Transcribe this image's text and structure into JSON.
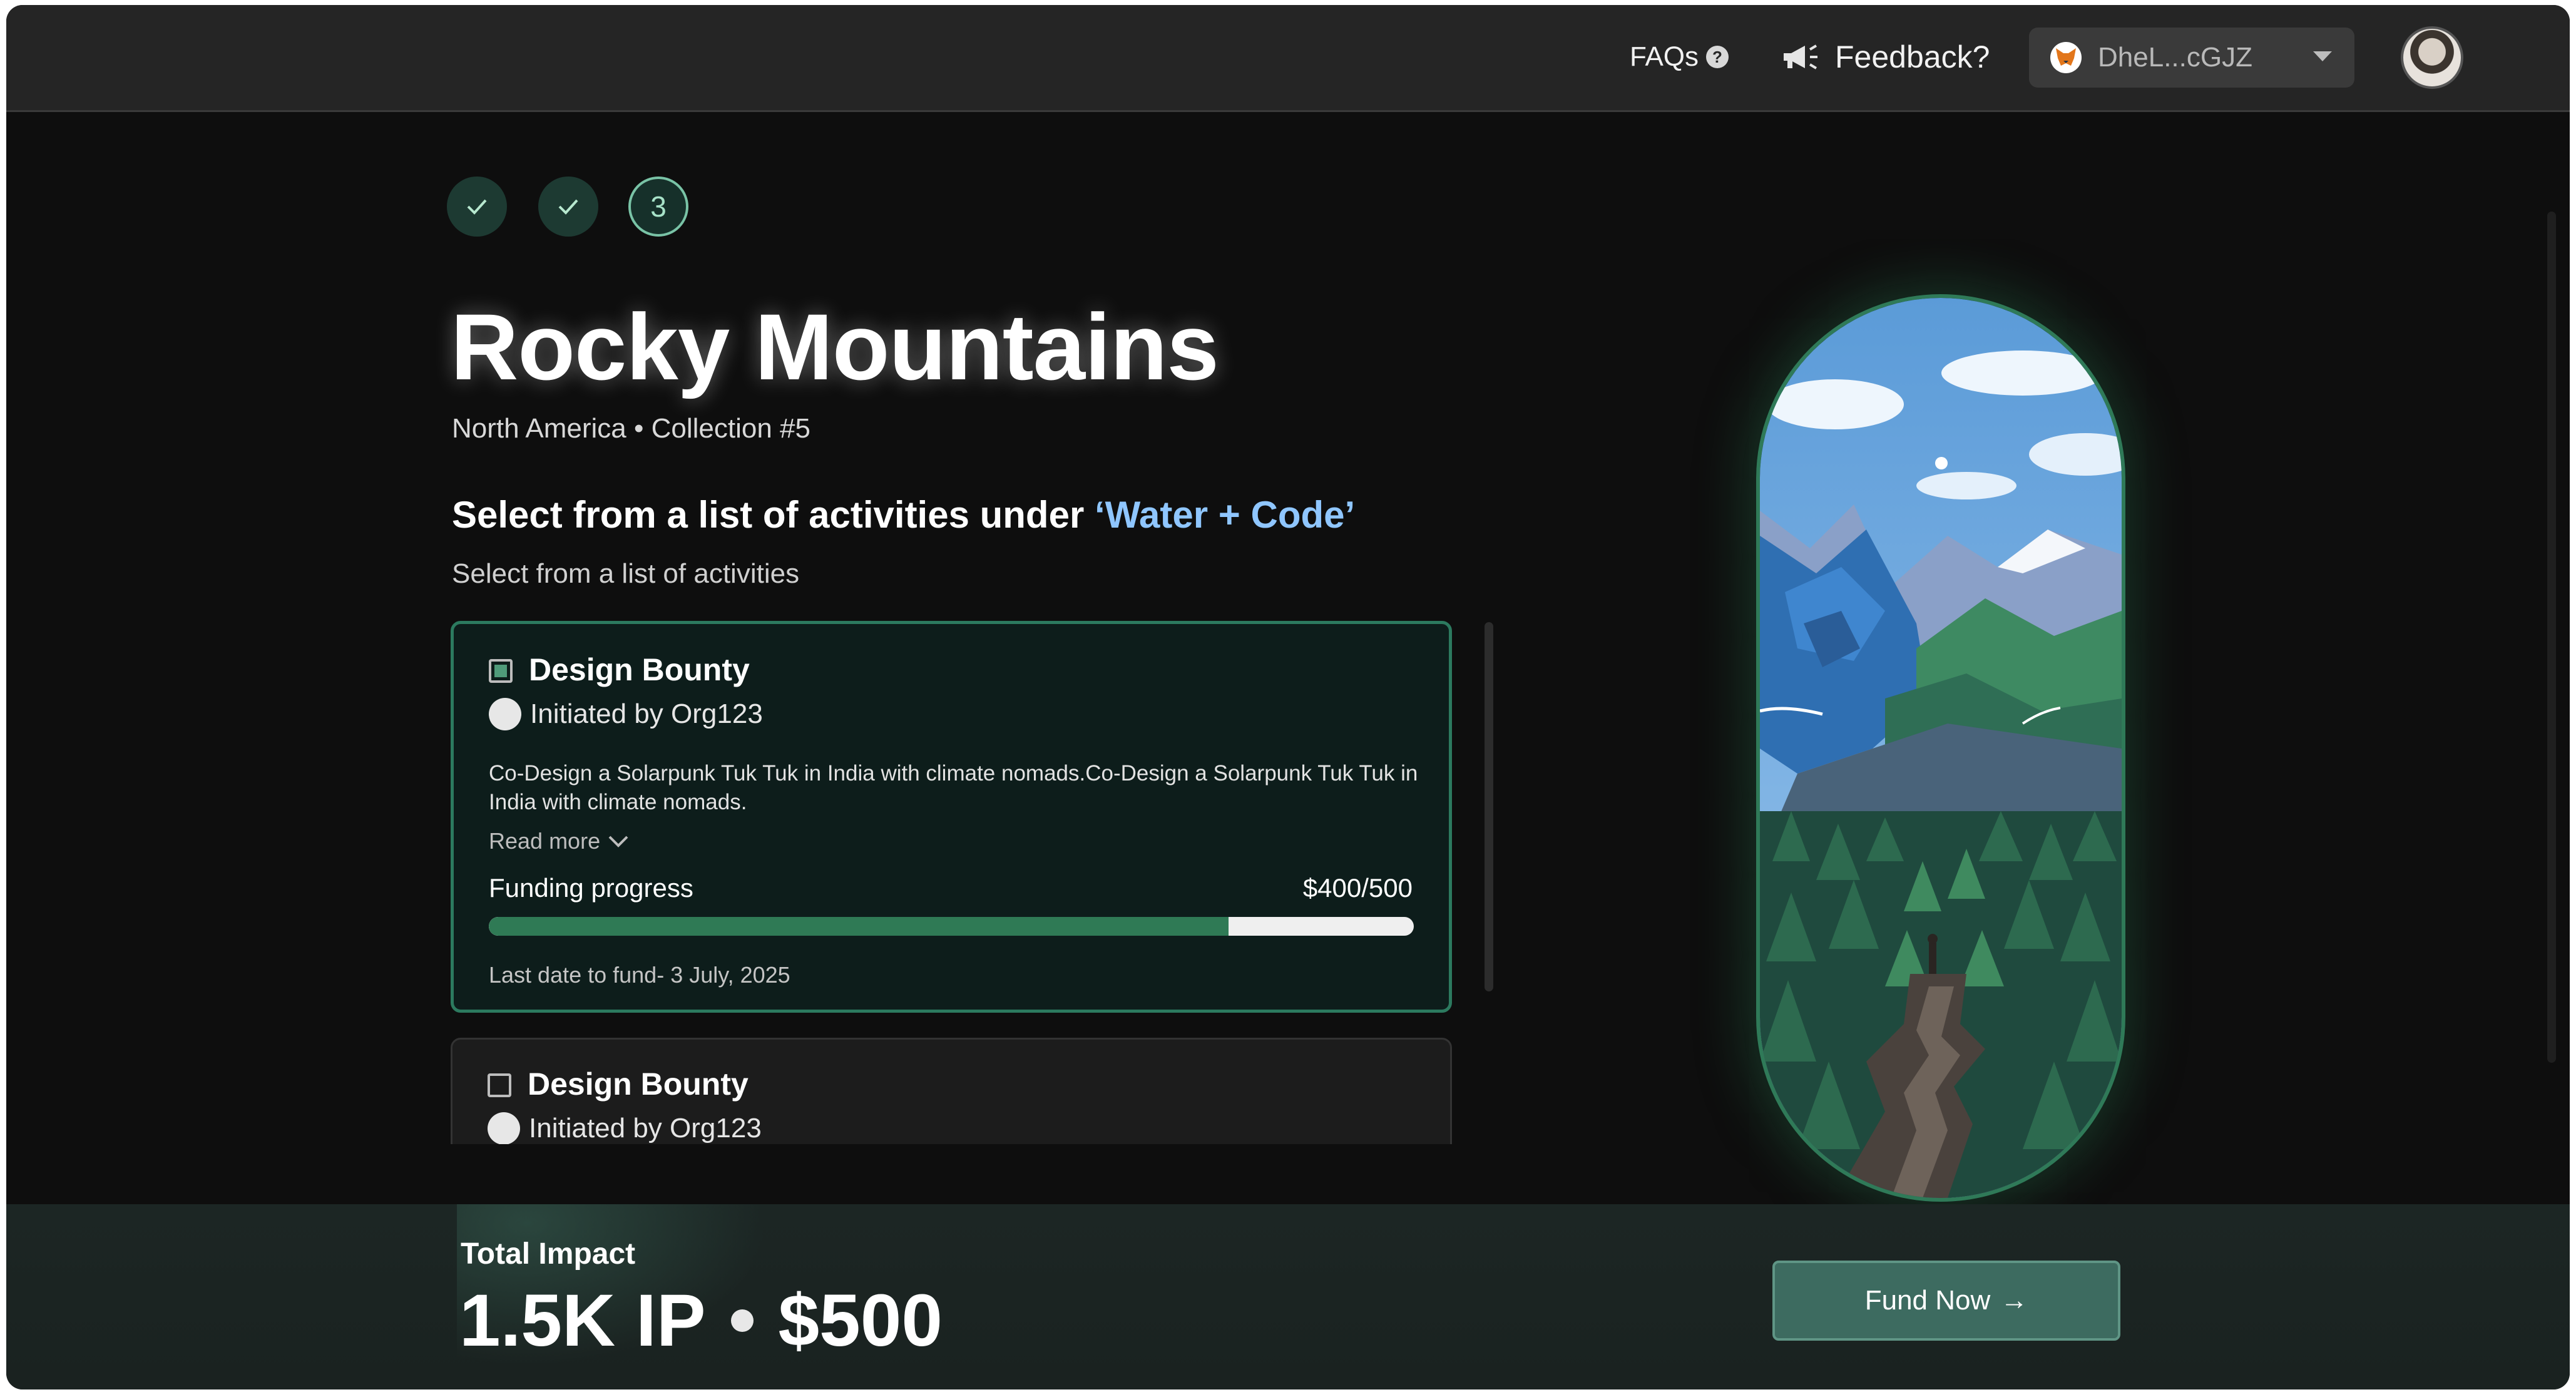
{
  "header": {
    "faqs_label": "FAQs",
    "feedback_label": "Feedback?",
    "wallet_address": "DheL...cGJZ"
  },
  "steps": [
    {
      "state": "done"
    },
    {
      "state": "done"
    },
    {
      "state": "current",
      "label": "3"
    }
  ],
  "page": {
    "title": "Rocky Mountains",
    "subtitle": "North America • Collection #5",
    "heading_prefix": "Select from a list of activities under ",
    "heading_highlight": "‘Water + Code’",
    "subheading": "Select from a list of activities"
  },
  "activities": [
    {
      "title": "Design Bounty",
      "checked": true,
      "initiated_by": "Initiated by Org123",
      "description": "Co-Design a Solarpunk Tuk Tuk in India with climate nomads.Co-Design a Solarpunk Tuk Tuk in India with climate nomads.",
      "read_more": "Read more",
      "funding_label": "Funding progress",
      "funding_amount": "$400/500",
      "funding_fraction": 0.8,
      "deadline": "Last date to fund- 3 July, 2025"
    },
    {
      "title": "Design Bounty",
      "checked": false,
      "initiated_by": "Initiated by Org123"
    }
  ],
  "footer": {
    "impact_label": "Total Impact",
    "impact_ip": "1.5K IP",
    "impact_usd": "$500",
    "fund_button": "Fund Now",
    "fund_arrow": "→"
  },
  "colors": {
    "accent_green": "#2f7a55",
    "highlight_blue": "#8fc6ff",
    "button_bg": "#3d6b60"
  },
  "icons": [
    "help-circle-icon",
    "megaphone-icon",
    "metamask-fox-icon",
    "chevron-down-icon",
    "check-icon",
    "arrow-right-icon"
  ]
}
